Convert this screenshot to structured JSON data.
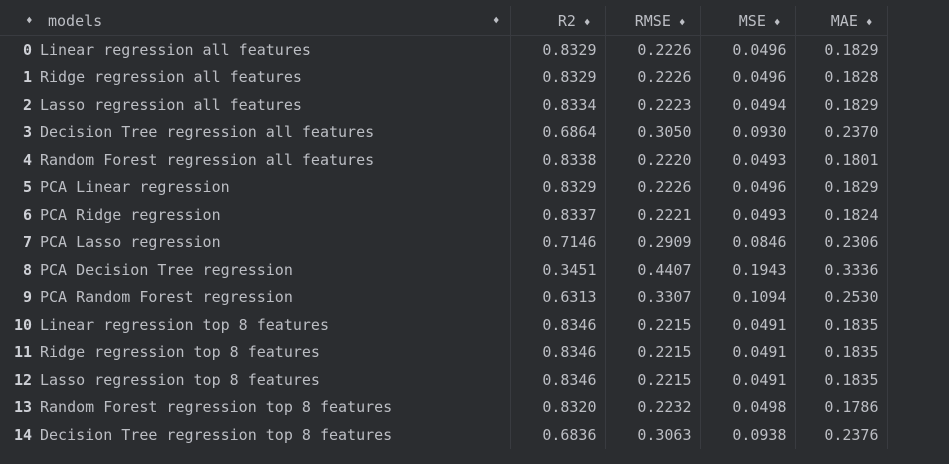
{
  "table": {
    "columns": [
      {
        "key": "index",
        "label": ""
      },
      {
        "key": "models",
        "label": "models"
      },
      {
        "key": "R2",
        "label": "R2"
      },
      {
        "key": "RMSE",
        "label": "RMSE"
      },
      {
        "key": "MSE",
        "label": "MSE"
      },
      {
        "key": "MAE",
        "label": "MAE"
      }
    ],
    "sort_glyph": "♦",
    "rows": [
      {
        "index": "0",
        "model": "Linear regression all features",
        "R2": "0.8329",
        "RMSE": "0.2226",
        "MSE": "0.0496",
        "MAE": "0.1829"
      },
      {
        "index": "1",
        "model": "Ridge regression all features",
        "R2": "0.8329",
        "RMSE": "0.2226",
        "MSE": "0.0496",
        "MAE": "0.1828"
      },
      {
        "index": "2",
        "model": "Lasso regression all features",
        "R2": "0.8334",
        "RMSE": "0.2223",
        "MSE": "0.0494",
        "MAE": "0.1829"
      },
      {
        "index": "3",
        "model": "Decision Tree regression all features",
        "R2": "0.6864",
        "RMSE": "0.3050",
        "MSE": "0.0930",
        "MAE": "0.2370"
      },
      {
        "index": "4",
        "model": "Random Forest regression all features",
        "R2": "0.8338",
        "RMSE": "0.2220",
        "MSE": "0.0493",
        "MAE": "0.1801"
      },
      {
        "index": "5",
        "model": "PCA Linear regression",
        "R2": "0.8329",
        "RMSE": "0.2226",
        "MSE": "0.0496",
        "MAE": "0.1829"
      },
      {
        "index": "6",
        "model": "PCA Ridge regression",
        "R2": "0.8337",
        "RMSE": "0.2221",
        "MSE": "0.0493",
        "MAE": "0.1824"
      },
      {
        "index": "7",
        "model": "PCA Lasso regression",
        "R2": "0.7146",
        "RMSE": "0.2909",
        "MSE": "0.0846",
        "MAE": "0.2306"
      },
      {
        "index": "8",
        "model": "PCA Decision Tree regression",
        "R2": "0.3451",
        "RMSE": "0.4407",
        "MSE": "0.1943",
        "MAE": "0.3336"
      },
      {
        "index": "9",
        "model": "PCA Random Forest regression",
        "R2": "0.6313",
        "RMSE": "0.3307",
        "MSE": "0.1094",
        "MAE": "0.2530"
      },
      {
        "index": "10",
        "model": "Linear regression top 8 features",
        "R2": "0.8346",
        "RMSE": "0.2215",
        "MSE": "0.0491",
        "MAE": "0.1835"
      },
      {
        "index": "11",
        "model": "Ridge regression top 8 features",
        "R2": "0.8346",
        "RMSE": "0.2215",
        "MSE": "0.0491",
        "MAE": "0.1835"
      },
      {
        "index": "12",
        "model": "Lasso regression top 8 features",
        "R2": "0.8346",
        "RMSE": "0.2215",
        "MSE": "0.0491",
        "MAE": "0.1835"
      },
      {
        "index": "13",
        "model": "Random Forest regression top 8 features",
        "R2": "0.8320",
        "RMSE": "0.2232",
        "MSE": "0.0498",
        "MAE": "0.1786"
      },
      {
        "index": "14",
        "model": "Decision Tree regression top 8 features",
        "R2": "0.6836",
        "RMSE": "0.3063",
        "MSE": "0.0938",
        "MAE": "0.2376"
      }
    ]
  },
  "colors": {
    "background": "#2b2d30",
    "text": "#bcbec4",
    "grid": "#393b40"
  }
}
